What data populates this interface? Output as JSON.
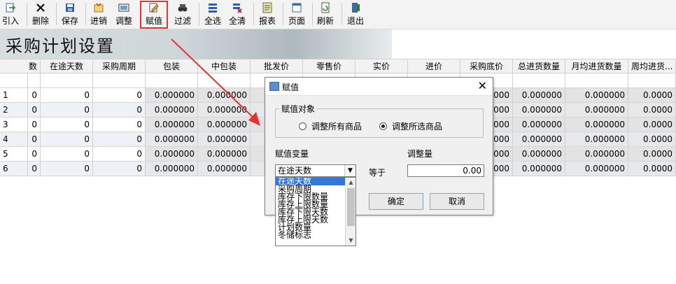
{
  "toolbar": {
    "buttons": [
      {
        "label": "引入",
        "icon": "import-icon"
      },
      {
        "label": "删除",
        "icon": "delete-icon"
      },
      {
        "label": "保存",
        "icon": "save-icon"
      },
      {
        "label": "进销",
        "icon": "purchase-sale-icon"
      },
      {
        "label": "调整",
        "icon": "adjust-icon"
      },
      {
        "label": "赋值",
        "icon": "assign-icon"
      },
      {
        "label": "过滤",
        "icon": "filter-icon"
      },
      {
        "label": "全选",
        "icon": "select-all-icon"
      },
      {
        "label": "全清",
        "icon": "clear-all-icon"
      },
      {
        "label": "报表",
        "icon": "report-icon"
      },
      {
        "label": "页面",
        "icon": "page-icon"
      },
      {
        "label": "刷新",
        "icon": "refresh-icon"
      },
      {
        "label": "退出",
        "icon": "exit-icon"
      }
    ]
  },
  "banner": {
    "title": "采购计划设置"
  },
  "grid": {
    "headers": [
      "数",
      "在途天数",
      "采购周期",
      "包装",
      "中包装",
      "批发价",
      "零售价",
      "实价",
      "进价",
      "采购底价",
      "总进货数量",
      "月均进货数量",
      "周均进货..."
    ],
    "rows": [
      {
        "id": "1",
        "cells": [
          "0",
          "0",
          "0",
          "0.000000",
          "0.000000",
          "",
          "",
          "",
          "",
          "000",
          "0.000000",
          "0.000000",
          "0.0000"
        ]
      },
      {
        "id": "2",
        "cells": [
          "0",
          "0",
          "0",
          "0.000000",
          "0.000000",
          "",
          "",
          "",
          "",
          "000",
          "0.000000",
          "0.000000",
          "0.0000"
        ]
      },
      {
        "id": "3",
        "cells": [
          "0",
          "0",
          "0",
          "0.000000",
          "0.000000",
          "",
          "",
          "",
          "",
          "000",
          "0.000000",
          "0.000000",
          "0.0000"
        ]
      },
      {
        "id": "4",
        "cells": [
          "0",
          "0",
          "0",
          "0.000000",
          "0.000000",
          "",
          "",
          "",
          "",
          "000",
          "0.000000",
          "0.000000",
          "0.0000"
        ]
      },
      {
        "id": "5",
        "cells": [
          "0",
          "0",
          "0",
          "0.000000",
          "0.000000",
          "",
          "",
          "",
          "",
          "000",
          "0.000000",
          "0.000000",
          "0.0000"
        ]
      },
      {
        "id": "6",
        "cells": [
          "0",
          "0",
          "0",
          "0.000000",
          "0.000000",
          "",
          "",
          "",
          "",
          "000",
          "0.000000",
          "0.000000",
          "0.0000"
        ]
      }
    ]
  },
  "dialog": {
    "title": "赋值",
    "close": "✕",
    "target_group": "赋值对象",
    "radio_all": "调整所有商品",
    "radio_selected": "调整所选商品",
    "variable_label": "赋值变量",
    "amount_label": "调整量",
    "variable_value": "在途天数",
    "equals": "等于",
    "amount_value": "0.00",
    "ok": "确定",
    "cancel": "取消"
  },
  "dropdown": {
    "options": [
      "在途天数",
      "采购周期",
      "库存下限数量",
      "库存上限数量",
      "库存下限天数",
      "库存上限天数",
      "计划数量",
      "冬储标志"
    ],
    "selected": "在途天数"
  },
  "colors": {
    "accent": "#e53333",
    "selection": "#3478d6"
  }
}
